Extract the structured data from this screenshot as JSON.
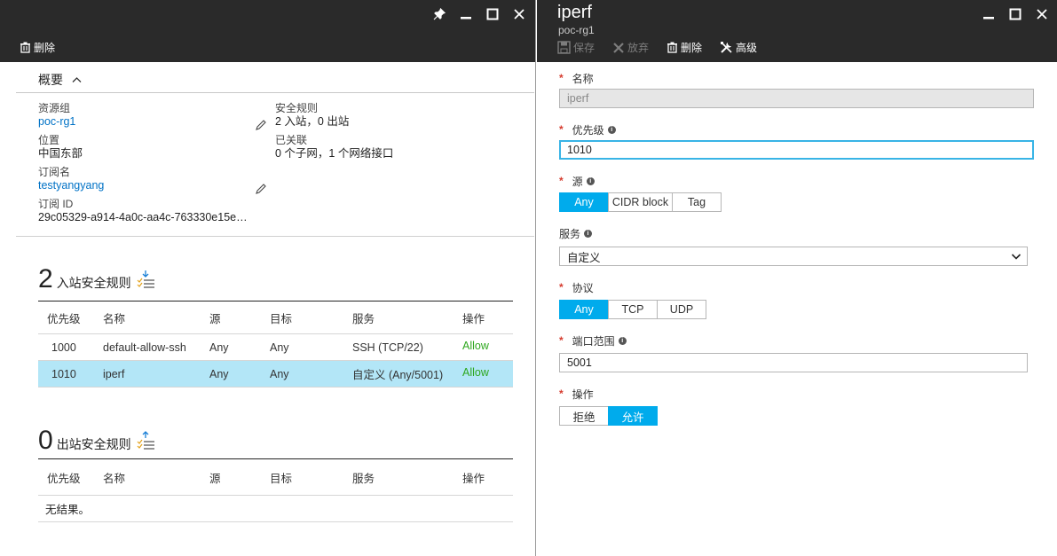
{
  "left_blade": {
    "commands": {
      "delete_label": "删除"
    },
    "essentials_toggle": "概要",
    "essentials": {
      "resource_group_label": "资源组",
      "resource_group_value": "poc-rg1",
      "location_label": "位置",
      "location_value": "中国东部",
      "subscription_label": "订阅名",
      "subscription_value": "testyangyang",
      "subscription_id_label": "订阅 ID",
      "subscription_id_value": "29c05329-a914-4a0c-aa4c-763330e15e…",
      "security_rules_label": "安全规则",
      "security_rules_value": "2 入站，0 出站",
      "associated_label": "已关联",
      "associated_value": "0 个子网，1 个网络接口"
    },
    "inbound": {
      "count": "2",
      "title": "入站安全规则",
      "headers": [
        "优先级",
        "名称",
        "源",
        "目标",
        "服务",
        "操作"
      ],
      "rows": [
        {
          "priority": "1000",
          "name": "default-allow-ssh",
          "source": "Any",
          "dest": "Any",
          "service": "SSH (TCP/22)",
          "action": "Allow"
        },
        {
          "priority": "1010",
          "name": "iperf",
          "source": "Any",
          "dest": "Any",
          "service": "自定义 (Any/5001)",
          "action": "Allow"
        }
      ]
    },
    "outbound": {
      "count": "0",
      "title": "出站安全规则",
      "headers": [
        "优先级",
        "名称",
        "源",
        "目标",
        "服务",
        "操作"
      ],
      "empty": "无结果。"
    }
  },
  "right_blade": {
    "title": "iperf",
    "subtitle": "poc-rg1",
    "commands": {
      "save_label": "保存",
      "discard_label": "放弃",
      "delete_label": "删除",
      "advanced_label": "高级"
    },
    "form": {
      "name_label": "名称",
      "name_value": "iperf",
      "priority_label": "优先级",
      "priority_value": "1010",
      "source_label": "源",
      "source_options": [
        "Any",
        "CIDR block",
        "Tag"
      ],
      "service_label": "服务",
      "service_value": "自定义",
      "protocol_label": "协议",
      "protocol_options": [
        "Any",
        "TCP",
        "UDP"
      ],
      "port_label": "端口范围",
      "port_value": "5001",
      "action_label": "操作",
      "action_options": [
        "拒绝",
        "允许"
      ]
    }
  },
  "colors": {
    "header_bg": "#2a2a2a",
    "accent": "#00abec",
    "link": "#0072c6",
    "allow": "#2ea71e",
    "selected_row": "#b3e6f7",
    "required": "#d63c2f"
  }
}
